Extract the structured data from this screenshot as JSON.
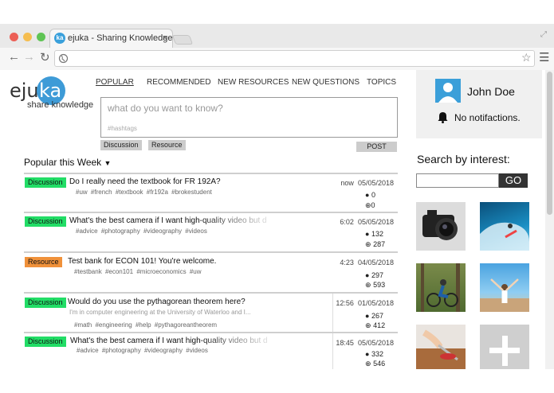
{
  "browser": {
    "tab_title": "ejuka - Sharing Knowledge",
    "tab_icon_text": "ka",
    "close_glyph": "×"
  },
  "logo": {
    "text": "eju",
    "highlight": "ka",
    "tagline": "share knowledge"
  },
  "nav": {
    "items": [
      "POPULAR",
      "RECOMMENDED",
      "NEW RESOURCES",
      "NEW QUESTIONS",
      "TOPICS"
    ]
  },
  "ask": {
    "placeholder": "what do you want to know?",
    "hashtags_placeholder": "#hashtags",
    "type_buttons": [
      "Discussion",
      "Resource"
    ],
    "post_label": "POST"
  },
  "feed": {
    "heading": "Popular this Week",
    "posts": [
      {
        "type": "Discussion",
        "title": "Do I really need the textbook for FR 192A?",
        "subtitle": "",
        "tags": [
          "#uw",
          "#french",
          "#textbook",
          "#fr192a",
          "#brokestudent"
        ],
        "time": "now",
        "date": "05/05/2018",
        "answers": "0",
        "upvotes": "0"
      },
      {
        "type": "Discussion",
        "title": "What's the best camera if I want high-quality video but d",
        "subtitle": "",
        "tags": [
          "#advice",
          "#photography",
          "#videography",
          "#videos"
        ],
        "time": "6:02",
        "date": "05/05/2018",
        "answers": "132",
        "upvotes": "287"
      },
      {
        "type": "Resource",
        "title": "Test bank for ECON 101! You're welcome.",
        "subtitle": "",
        "tags": [
          "#testbank",
          "#econ101",
          "#microeconomics",
          "#uw"
        ],
        "time": "4:23",
        "date": "04/05/2018",
        "answers": "297",
        "upvotes": "593"
      },
      {
        "type": "Discussion",
        "title": "Would do you use the pythagorean theorem here?",
        "subtitle": "I'm in computer engineering at the University of Waterloo and I...",
        "tags": [
          "#math",
          "#engineering",
          "#help",
          "#pythagoreantheorem"
        ],
        "time": "12:56",
        "date": "01/05/2018",
        "answers": "267",
        "upvotes": "412"
      },
      {
        "type": "Discussion",
        "title": "What's the best camera if I want high-quality video but d",
        "subtitle": "",
        "tags": [
          "#advice",
          "#photography",
          "#videography",
          "#videos"
        ],
        "time": "18:45",
        "date": "05/05/2018",
        "answers": "332",
        "upvotes": "546"
      }
    ]
  },
  "user": {
    "name": "John Doe",
    "notifications": "No notifactions."
  },
  "interest": {
    "heading": "Search by interest:",
    "go_label": "GO"
  },
  "colors": {
    "accent": "#3e9bd7",
    "discussion": "#22dd66",
    "resource": "#f0913a",
    "go_bg": "#333333"
  },
  "icons": [
    "back-arrow-icon",
    "forward-arrow-icon",
    "reload-icon",
    "globe-icon",
    "star-icon",
    "menu-icon",
    "bell-icon",
    "user-avatar-icon",
    "answers-dot-icon",
    "upvote-plus-icon",
    "dropdown-caret-icon"
  ]
}
